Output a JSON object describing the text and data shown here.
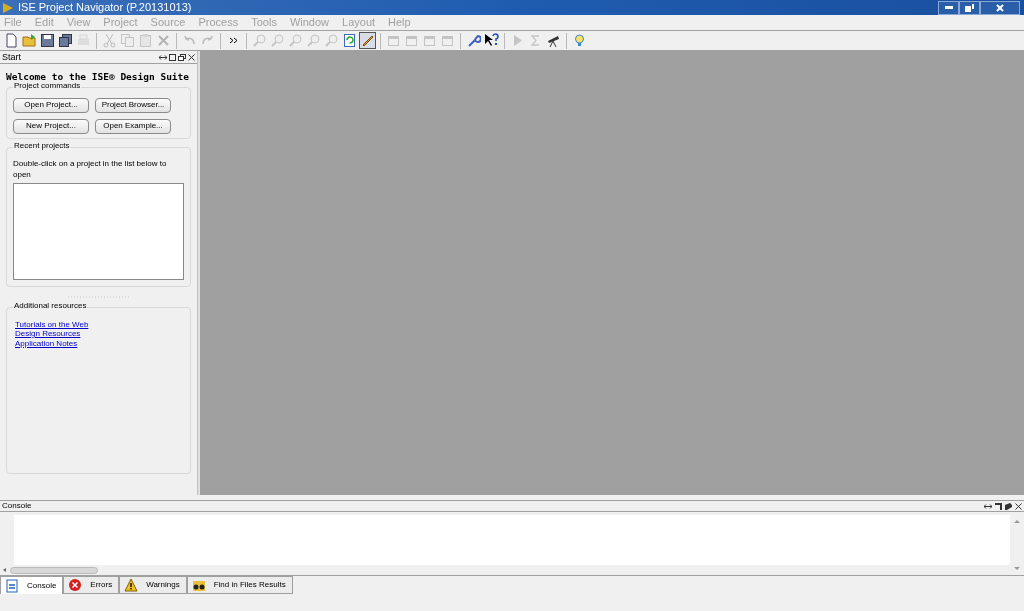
{
  "window": {
    "title": "ISE Project Navigator (P.20131013)"
  },
  "menu": [
    {
      "label": "File",
      "disabled": true
    },
    {
      "label": "Edit",
      "disabled": true
    },
    {
      "label": "View",
      "disabled": true
    },
    {
      "label": "Project",
      "disabled": true
    },
    {
      "label": "Source",
      "disabled": true
    },
    {
      "label": "Process",
      "disabled": true
    },
    {
      "label": "Tools",
      "disabled": true
    },
    {
      "label": "Window",
      "disabled": true
    },
    {
      "label": "Layout",
      "disabled": true
    },
    {
      "label": "Help",
      "disabled": true
    }
  ],
  "toolbar": [
    {
      "kind": "new",
      "disabled": false
    },
    {
      "kind": "open",
      "disabled": false
    },
    {
      "kind": "save",
      "disabled": false
    },
    {
      "kind": "saveall",
      "disabled": false
    },
    {
      "kind": "print",
      "disabled": true
    },
    {
      "kind": "sep"
    },
    {
      "kind": "cut",
      "disabled": true
    },
    {
      "kind": "copy",
      "disabled": true
    },
    {
      "kind": "paste",
      "disabled": true
    },
    {
      "kind": "delete",
      "disabled": true
    },
    {
      "kind": "sep"
    },
    {
      "kind": "undo",
      "disabled": true
    },
    {
      "kind": "redo",
      "disabled": true
    },
    {
      "kind": "sep"
    },
    {
      "kind": "more",
      "disabled": false
    },
    {
      "kind": "sep"
    },
    {
      "kind": "zoom",
      "disabled": true
    },
    {
      "kind": "zoom",
      "disabled": true
    },
    {
      "kind": "zoom",
      "disabled": true
    },
    {
      "kind": "zoom",
      "disabled": true
    },
    {
      "kind": "zoom",
      "disabled": true
    },
    {
      "kind": "refresh",
      "disabled": false
    },
    {
      "kind": "pen",
      "disabled": false,
      "selected": true
    },
    {
      "kind": "sep"
    },
    {
      "kind": "window",
      "disabled": true
    },
    {
      "kind": "window",
      "disabled": true
    },
    {
      "kind": "window",
      "disabled": true
    },
    {
      "kind": "window",
      "disabled": true
    },
    {
      "kind": "sep"
    },
    {
      "kind": "wrench",
      "disabled": false
    },
    {
      "kind": "help",
      "disabled": false
    },
    {
      "kind": "sep"
    },
    {
      "kind": "run",
      "disabled": true
    },
    {
      "kind": "sigma",
      "disabled": true
    },
    {
      "kind": "scope",
      "disabled": false
    },
    {
      "kind": "sep"
    },
    {
      "kind": "bulb",
      "disabled": false
    }
  ],
  "start_panel": {
    "title": "Start",
    "heading": "Welcome to the ISE® Design Suite",
    "project_commands": {
      "title": "Project commands",
      "buttons": [
        "Open Project...",
        "Project Browser...",
        "New Project...",
        "Open Example..."
      ]
    },
    "recent_projects": {
      "title": "Recent projects",
      "hint": "Double-click on a project in the list below to open"
    },
    "additional_resources": {
      "title": "Additional resources",
      "links": [
        "Tutorials on the Web",
        "Design Resources",
        "Application Notes"
      ]
    }
  },
  "console": {
    "title": "Console"
  },
  "bottom_tabs": [
    {
      "label": "Console",
      "kind": "console",
      "selected": true
    },
    {
      "label": "Errors",
      "kind": "errors",
      "selected": false
    },
    {
      "label": "Warnings",
      "kind": "warnings",
      "selected": false
    },
    {
      "label": "Find in Files Results",
      "kind": "find",
      "selected": false
    }
  ]
}
